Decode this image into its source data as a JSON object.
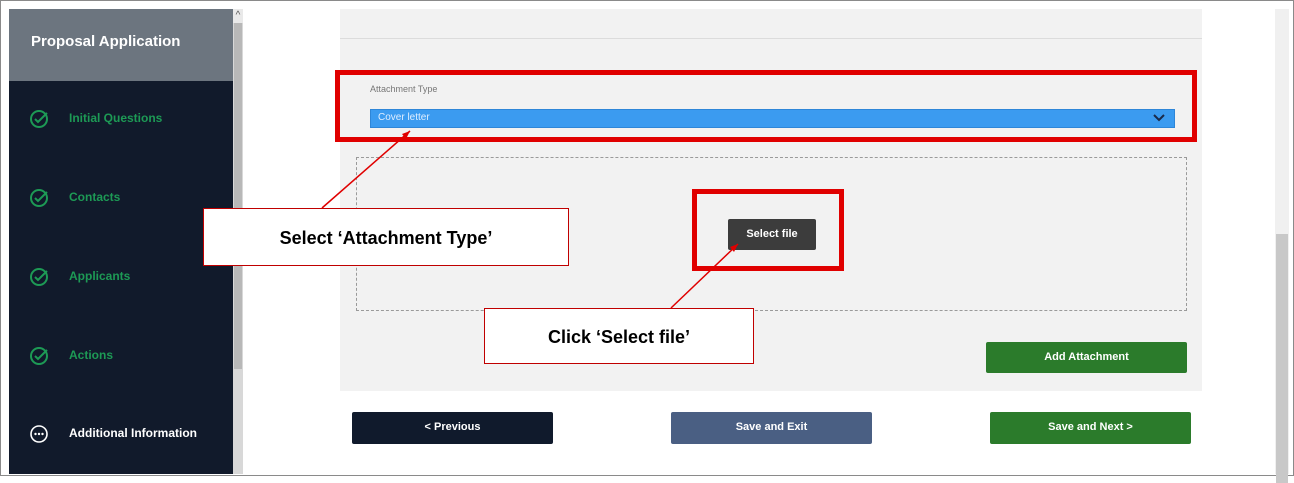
{
  "sidebar": {
    "title": "Proposal Application",
    "items": [
      {
        "label": "Initial Questions",
        "icon": "check-circle-icon"
      },
      {
        "label": "Contacts",
        "icon": "check-circle-icon"
      },
      {
        "label": "Applicants",
        "icon": "check-circle-icon"
      },
      {
        "label": "Actions",
        "icon": "check-circle-icon"
      },
      {
        "label": "Additional Information",
        "icon": "ellipsis-circle-icon"
      }
    ]
  },
  "attachment": {
    "type_label": "Attachment Type",
    "selected_type": "Cover letter",
    "select_file_label": "Select file",
    "add_label": "Add Attachment"
  },
  "nav": {
    "previous": "< Previous",
    "save_exit": "Save and Exit",
    "save_next": "Save and Next >"
  },
  "annotations": {
    "callout_type": "Select ‘Attachment Type’",
    "callout_file": "Click ‘Select file’"
  },
  "colors": {
    "sidebar_bg": "#111a2b",
    "accent_green": "#2b7b2b",
    "annotation_red": "#e00000",
    "select_highlight": "#3b9bf0"
  }
}
